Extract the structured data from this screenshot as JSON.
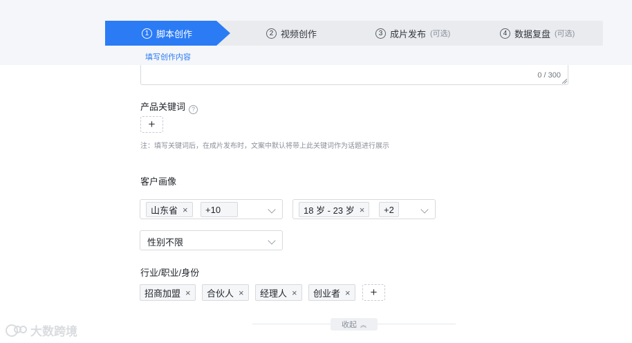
{
  "steps": [
    {
      "num": "①",
      "label": "脚本创作",
      "optional": ""
    },
    {
      "num": "②",
      "label": "视频创作",
      "optional": ""
    },
    {
      "num": "③",
      "label": "成片发布",
      "optional": "(可选)"
    },
    {
      "num": "④",
      "label": "数据复盘",
      "optional": "(可选)"
    }
  ],
  "step_sub": "填写创作内容",
  "textarea": {
    "counter": "0 / 300"
  },
  "keywords": {
    "label": "产品关键词",
    "help": "?",
    "add": "+",
    "note": "注：填写关键词后，在成片发布时，文案中默认将带上此关键词作为话题进行展示"
  },
  "portrait": {
    "label": "客户画像",
    "region": {
      "tag": "山东省",
      "more": "+10"
    },
    "age": {
      "tag": "18 岁 - 23 岁",
      "more": "+2"
    },
    "gender": "性别不限"
  },
  "industry": {
    "label": "行业/职业/身份",
    "tags": [
      "招商加盟",
      "合伙人",
      "经理人",
      "创业者"
    ],
    "add": "+"
  },
  "collapse": {
    "label": "收起",
    "icon": "︽"
  },
  "watermark": "大数跨境",
  "remove_glyph": "×",
  "colors": {
    "accent": "#2b7bf5"
  }
}
